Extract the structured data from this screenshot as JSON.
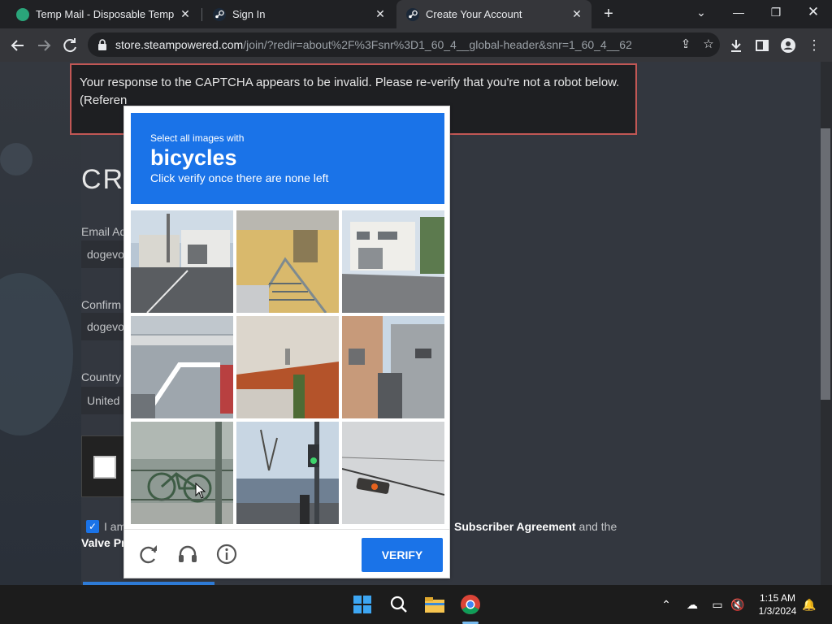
{
  "browser": {
    "tabs": [
      {
        "title": "Temp Mail - Disposable Tempora",
        "favicon": "tempmail-icon",
        "active": false
      },
      {
        "title": "Sign In",
        "favicon": "steam-icon",
        "active": false
      },
      {
        "title": "Create Your Account",
        "favicon": "steam-icon",
        "active": true
      }
    ],
    "new_tab_label": "+",
    "url_host": "store.steampowered.com",
    "url_path": "/join/?redir=about%2F%3Fsnr%3D1_60_4__global-header&snr=1_60_4__62"
  },
  "page": {
    "error_text": "Your response to the CAPTCHA appears to be invalid. Please re-verify that you're not a robot below.",
    "error_ref": "(Referen",
    "heading": "CRE",
    "email_label": "Email Ad",
    "email_value": "dogevo",
    "confirm_label": "Confirm",
    "confirm_value": "dogevo",
    "country_label": "Country",
    "country_value": "United",
    "agree_prefix": "I am",
    "agree_link1": "Subscriber Agreement",
    "agree_mid": "and the",
    "agree_link2": "Valve Pr"
  },
  "captcha": {
    "instruction": "Select all images with",
    "target": "bicycles",
    "hint": "Click verify once there are none left",
    "verify_label": "VERIFY",
    "tiles": [
      {
        "name": "tile-street-garage",
        "description": "street"
      },
      {
        "name": "tile-yellow-building-stairs",
        "description": "stairs"
      },
      {
        "name": "tile-white-house-corner",
        "description": "house"
      },
      {
        "name": "tile-building-stairs",
        "description": "stairs"
      },
      {
        "name": "tile-rooftop",
        "description": "roof"
      },
      {
        "name": "tile-narrow-street",
        "description": "street"
      },
      {
        "name": "tile-bicycle-railing",
        "description": "bicycle"
      },
      {
        "name": "tile-traffic-light-street",
        "description": "traffic light"
      },
      {
        "name": "tile-traffic-light-sky",
        "description": "traffic light"
      }
    ]
  },
  "taskbar": {
    "time": "1:15 AM",
    "date": "1/3/2024"
  },
  "colors": {
    "captcha_blue": "#1a73e8",
    "error_border": "#c15755",
    "page_bg": "#33373f"
  }
}
